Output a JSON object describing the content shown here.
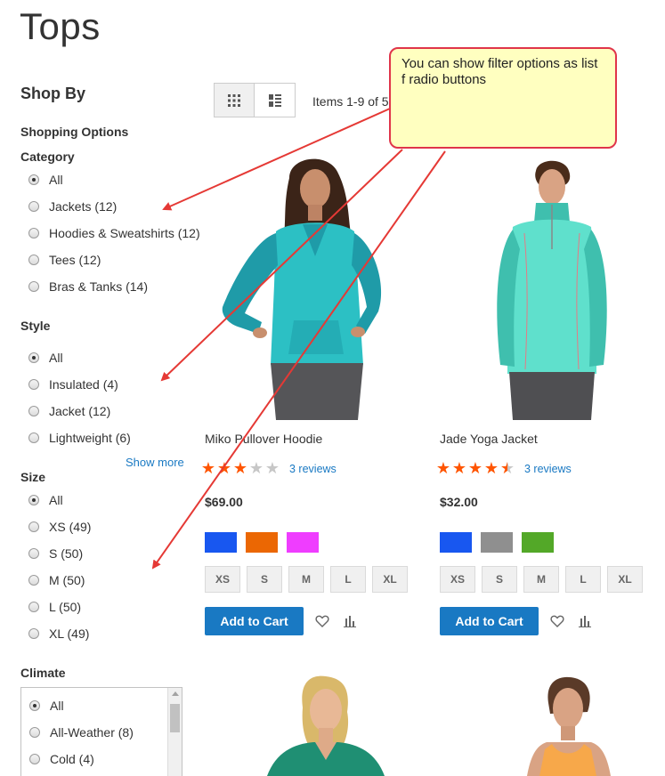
{
  "page": {
    "title": "Tops"
  },
  "sidebar": {
    "shop_by": "Shop By",
    "shopping_options": "Shopping Options",
    "category": {
      "title": "Category",
      "options": [
        {
          "label": "All",
          "checked": true
        },
        {
          "label": "Jackets (12)",
          "checked": false
        },
        {
          "label": "Hoodies & Sweatshirts (12)",
          "checked": false
        },
        {
          "label": "Tees (12)",
          "checked": false
        },
        {
          "label": "Bras & Tanks (14)",
          "checked": false
        }
      ]
    },
    "style": {
      "title": "Style",
      "options": [
        {
          "label": "All",
          "checked": true
        },
        {
          "label": "Insulated (4)",
          "checked": false
        },
        {
          "label": "Jacket (12)",
          "checked": false
        },
        {
          "label": "Lightweight (6)",
          "checked": false
        }
      ],
      "show_more": "Show more"
    },
    "size": {
      "title": "Size",
      "options": [
        {
          "label": "All",
          "checked": true
        },
        {
          "label": "XS (49)",
          "checked": false
        },
        {
          "label": "S (50)",
          "checked": false
        },
        {
          "label": "M (50)",
          "checked": false
        },
        {
          "label": "L (50)",
          "checked": false
        },
        {
          "label": "XL (49)",
          "checked": false
        }
      ]
    },
    "climate": {
      "title": "Climate",
      "options": [
        {
          "label": "All",
          "checked": true
        },
        {
          "label": "All-Weather (8)",
          "checked": false
        },
        {
          "label": "Cold (4)",
          "checked": false
        }
      ]
    }
  },
  "toolbar": {
    "items_count": "Items 1-9 of 5",
    "grid_icon": "grid-view-icon",
    "list_icon": "list-view-icon"
  },
  "products": [
    {
      "name": "Miko Pullover Hoodie",
      "rating_stars": 3,
      "reviews": "3 reviews",
      "price": "$69.00",
      "swatches": [
        "#1857f0",
        "#eb6703",
        "#ef3dff"
      ],
      "sizes": [
        "XS",
        "S",
        "M",
        "L",
        "XL"
      ],
      "add_to_cart": "Add to Cart",
      "shirt_color": "#2cc0c4",
      "shirt_dark": "#1f9ba8"
    },
    {
      "name": "Jade Yoga Jacket",
      "rating_stars": 4.5,
      "reviews": "3 reviews",
      "price": "$32.00",
      "swatches": [
        "#1857f0",
        "#8f8f8f",
        "#53a828"
      ],
      "sizes": [
        "XS",
        "S",
        "M",
        "L",
        "XL"
      ],
      "add_to_cart": "Add to Cart",
      "shirt_color": "#5fe0cc",
      "shirt_dark": "#3fbfae"
    }
  ],
  "colors": {
    "link": "#1979c3",
    "star_filled": "#ff5501",
    "star_empty": "#c7c7c7",
    "callout_bg": "#ffffc0",
    "callout_border": "#e0354a",
    "arrow": "#e53935"
  },
  "callout": {
    "text": "You can show filter options as list f radio buttons"
  }
}
